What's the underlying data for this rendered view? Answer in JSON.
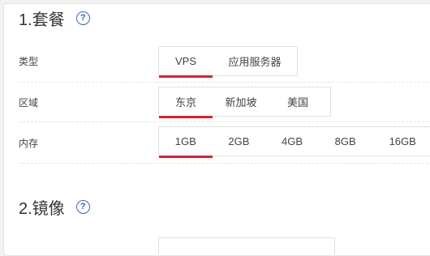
{
  "sections": [
    {
      "title": "1.套餐",
      "help_icon": "question-circle-icon"
    },
    {
      "title": "2.镜像",
      "help_icon": "question-circle-icon"
    }
  ],
  "rows": {
    "type": {
      "label": "类型",
      "options": [
        "VPS",
        "应用服务器"
      ],
      "selected": "VPS"
    },
    "region": {
      "label": "区域",
      "options": [
        "东京",
        "新加坡",
        "美国"
      ],
      "selected": "东京"
    },
    "memory": {
      "label": "内存",
      "options": [
        "1GB",
        "2GB",
        "4GB",
        "8GB",
        "16GB"
      ],
      "selected": "1GB"
    }
  },
  "colors": {
    "accent": "#d9232a",
    "help_icon": "#3b62b8"
  }
}
